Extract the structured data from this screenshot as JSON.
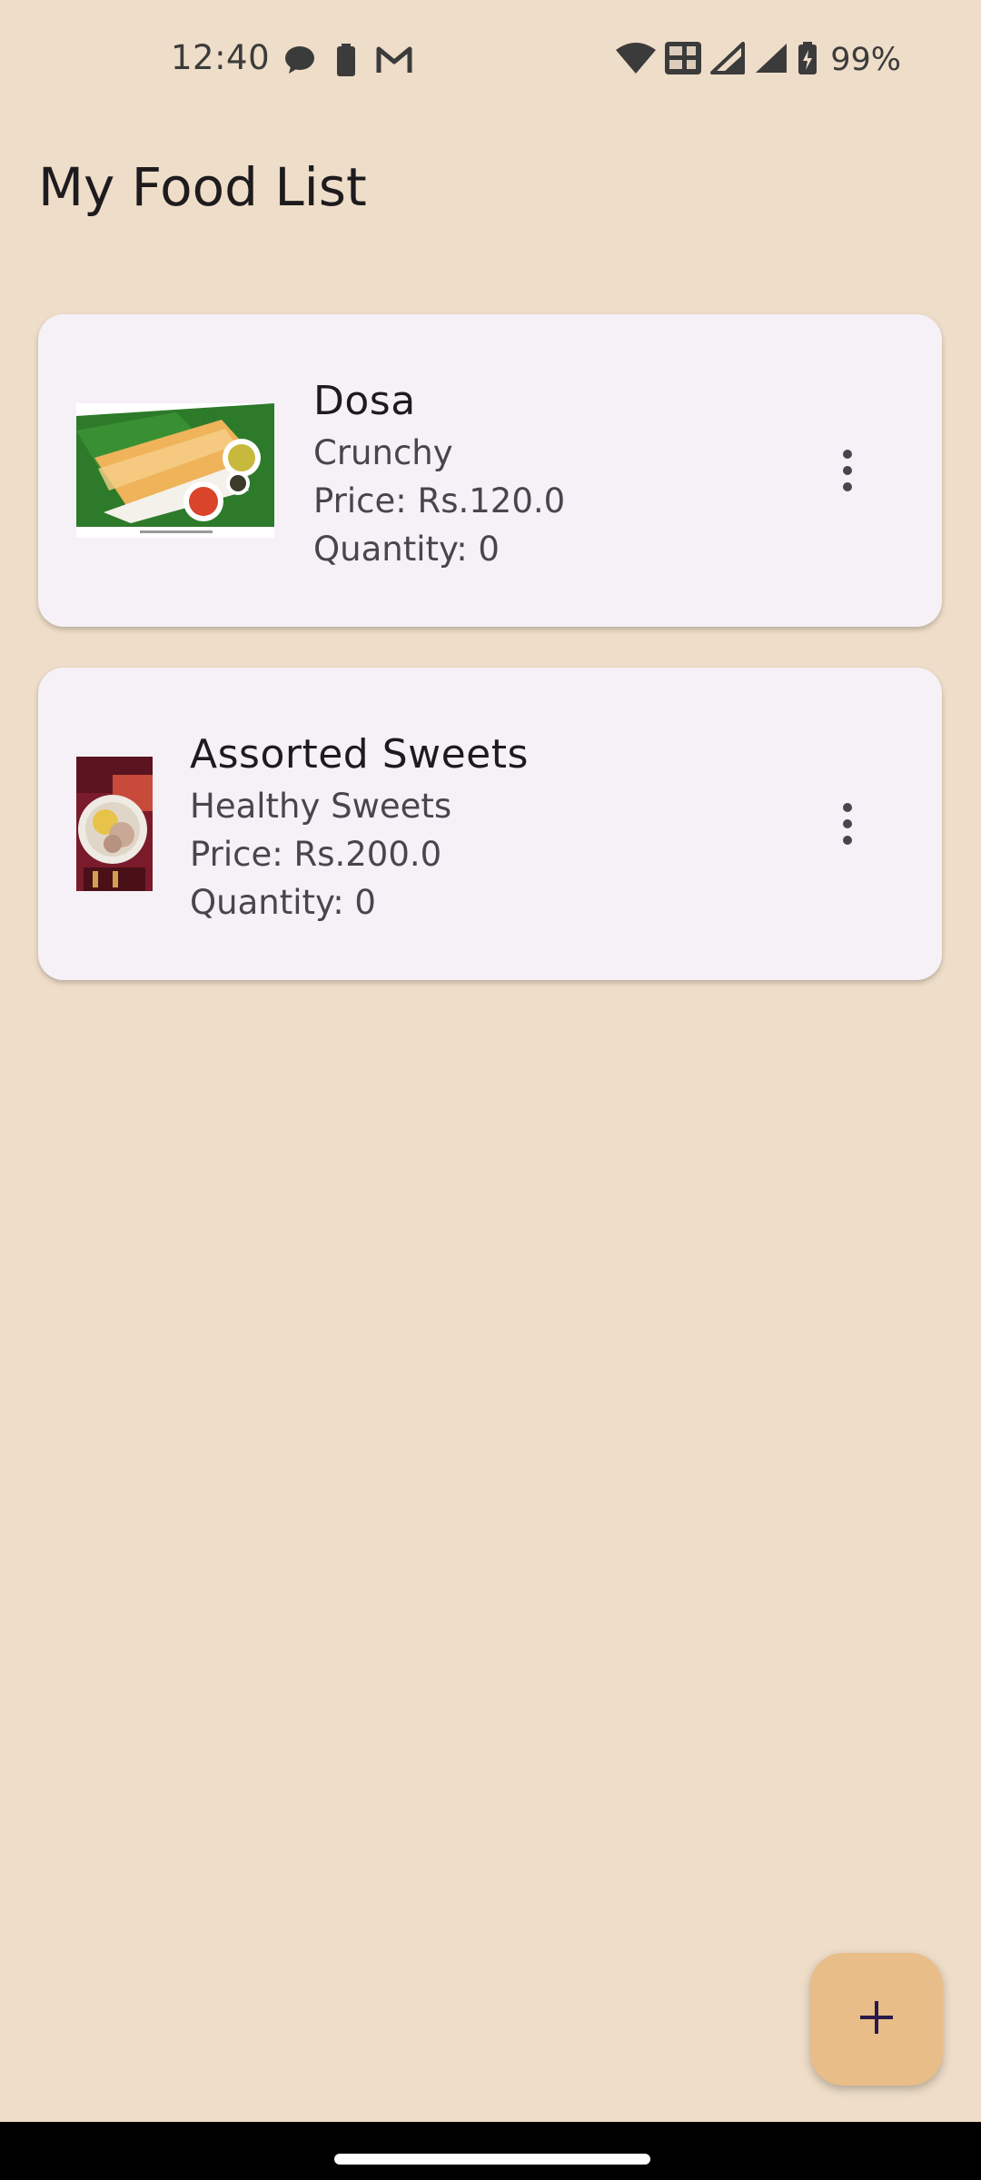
{
  "status_bar": {
    "time": "12:40",
    "battery_percent": "99%",
    "left_icons": [
      "chat-bubble-icon",
      "battery-saver-icon",
      "gmail-icon"
    ],
    "right_icons": [
      "wifi-icon",
      "volte-icon",
      "signal-icon",
      "signal-icon",
      "battery-charging-icon"
    ]
  },
  "page": {
    "title": "My Food List"
  },
  "food_items": [
    {
      "name": "Dosa",
      "description": "Crunchy",
      "price": "Price: Rs.120.0",
      "quantity": "Quantity: 0"
    },
    {
      "name": "Assorted Sweets",
      "description": "Healthy Sweets",
      "price": "Price: Rs.200.0",
      "quantity": "Quantity: 0"
    }
  ],
  "fab": {
    "icon": "plus-icon"
  },
  "colors": {
    "background": "#EEDDC8",
    "card": "#F6F1F7",
    "fab": "#E8BD88",
    "fab_icon": "#2a1a4a"
  }
}
